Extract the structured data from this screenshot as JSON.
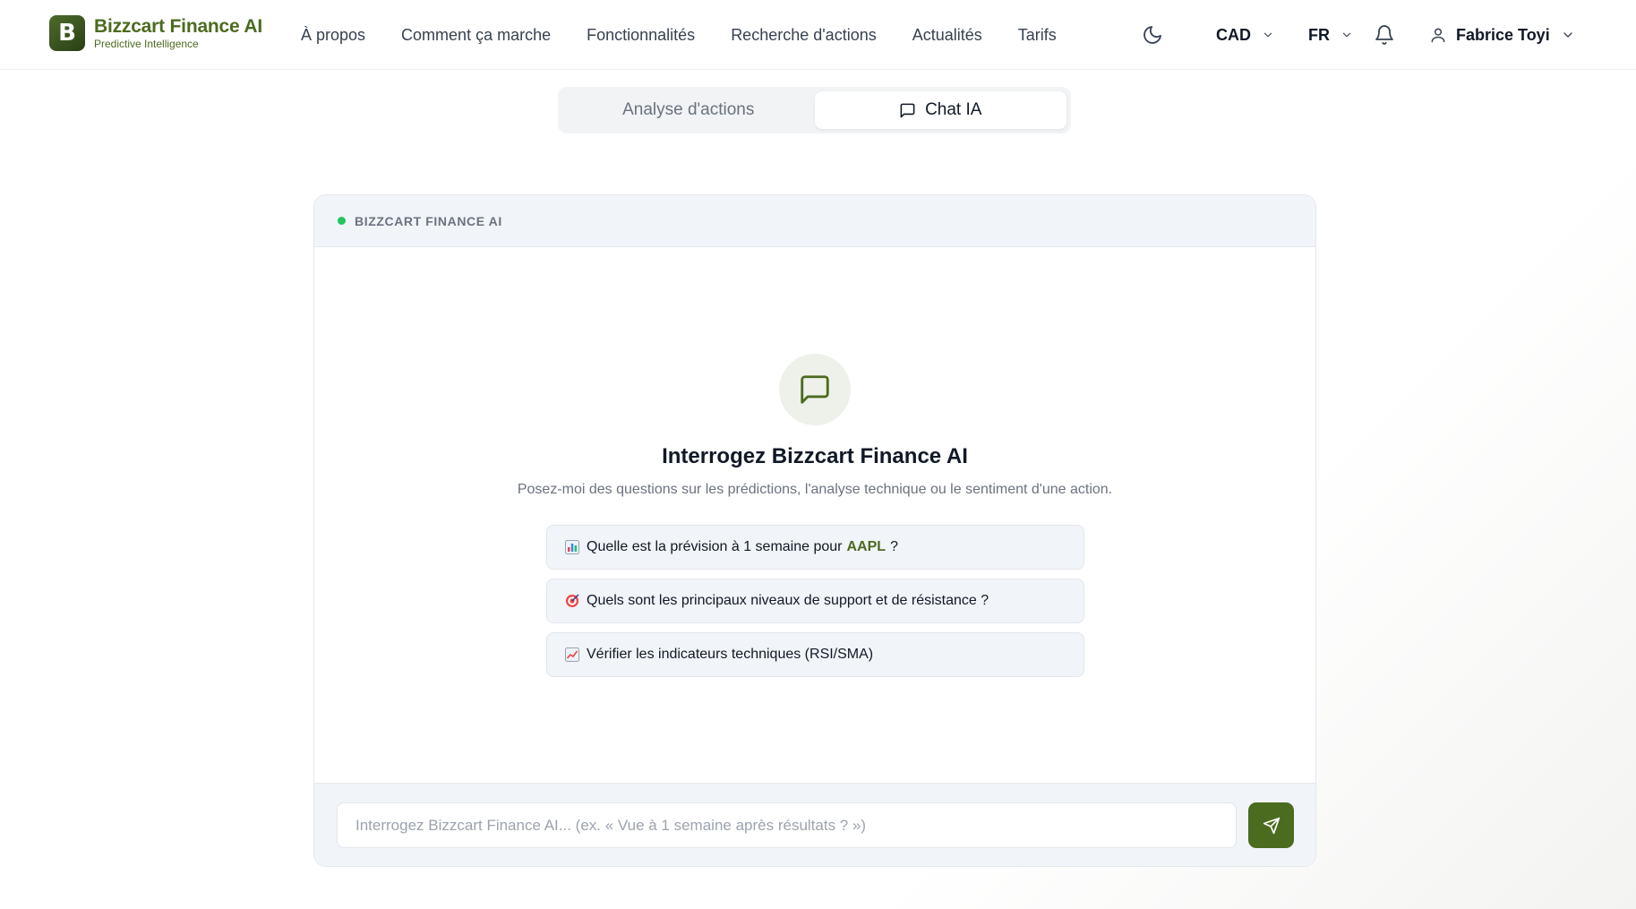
{
  "brand": {
    "name": "Bizzcart Finance AI",
    "tagline": "Predictive Intelligence",
    "logo_letter": "B",
    "color": "#4b6b1f"
  },
  "nav": {
    "items": [
      {
        "label": "À propos"
      },
      {
        "label": "Comment ça marche"
      },
      {
        "label": "Fonctionnalités"
      },
      {
        "label": "Recherche d'actions"
      },
      {
        "label": "Actualités"
      },
      {
        "label": "Tarifs"
      }
    ]
  },
  "toolbar": {
    "theme_icon": "moon-icon",
    "currency": "CAD",
    "language": "FR",
    "notifications_icon": "bell-icon",
    "user_name": "Fabrice Toyi"
  },
  "tabs": [
    {
      "label": "Analyse d'actions",
      "active": false
    },
    {
      "label": "Chat IA",
      "active": true,
      "icon": "chat-icon"
    }
  ],
  "chat": {
    "header_title": "BIZZCART FINANCE AI",
    "status_color": "#22c55e",
    "empty_title": "Interrogez Bizzcart Finance AI",
    "empty_subtitle": "Posez-moi des questions sur les prédictions, l'analyse technique ou le sentiment d'une action.",
    "suggestions": [
      {
        "icon": "bar-chart-emoji",
        "prefix": "Quelle est la prévision à 1 semaine pour",
        "ticker": "AAPL",
        "suffix": "?"
      },
      {
        "icon": "target-emoji",
        "text": "Quels sont les principaux niveaux de support et de résistance ?"
      },
      {
        "icon": "trend-up-emoji",
        "text": "Vérifier les indicateurs techniques (RSI/SMA)"
      }
    ],
    "input_placeholder": "Interrogez Bizzcart Finance AI... (ex. « Vue à 1 semaine après résultats ? »)",
    "input_value": "",
    "send_icon": "send-icon"
  }
}
